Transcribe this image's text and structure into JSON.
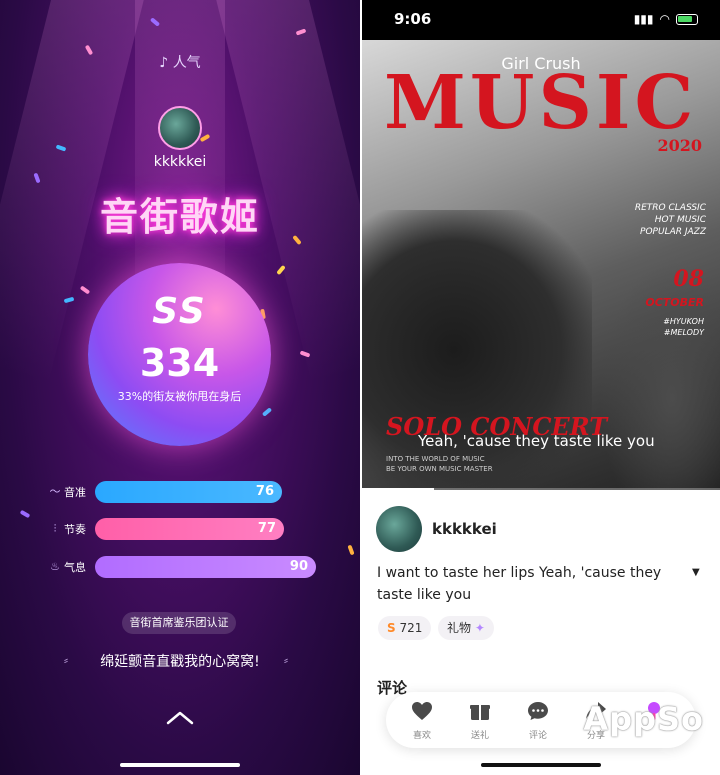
{
  "left": {
    "hot_label": "人气",
    "username": "kkkkkei",
    "title": "音街歌姬",
    "grade": "SS",
    "score": "334",
    "rank_text": "33%的街友被你甩在身后",
    "stats": [
      {
        "label": "音准",
        "value": "76",
        "level": 76,
        "color_from": "#2aa8ff",
        "color_to": "#4ab8ff"
      },
      {
        "label": "节奏",
        "value": "77",
        "level": 77,
        "color_from": "#ff5fa8",
        "color_to": "#ff7fc2"
      },
      {
        "label": "气息",
        "value": "90",
        "level": 90,
        "color_from": "#b16cff",
        "color_to": "#c98bff"
      }
    ],
    "certification": "音街首席鉴乐团认证",
    "slogan": "绵延颤音直戳我的心窝窝!"
  },
  "right": {
    "time": "9:06",
    "song_title": "Girl Crush",
    "magazine": {
      "title": "MUSIC",
      "year": "2020",
      "right_text": [
        "RETRO CLASSIC",
        "HOT MUSIC",
        "POPULAR JAZZ"
      ],
      "date": "08",
      "month": "OCTOBER",
      "tags": [
        "#HYUKOH",
        "#MELODY"
      ],
      "concert": "SOLO CONCERT",
      "sub": [
        "INTO THE WORLD OF MUSIC",
        "BE YOUR OWN MUSIC MASTER"
      ]
    },
    "live_lyric": "Yeah, 'cause they taste like you",
    "progress": 0.2,
    "username": "kkkkkei",
    "caption": "I want to taste her lips Yeah, 'cause they taste like you",
    "grade_chip": {
      "grade": "S",
      "value": "721"
    },
    "gift_chip": "礼物",
    "comments_heading": "评论",
    "actions": [
      {
        "label": "喜欢",
        "icon": "heart-icon"
      },
      {
        "label": "送礼",
        "icon": "gift-icon"
      },
      {
        "label": "评论",
        "icon": "comment-icon"
      },
      {
        "label": "分享",
        "icon": "share-icon"
      },
      {
        "label": "",
        "icon": "mic-icon"
      }
    ],
    "watermark": "AppSo"
  }
}
